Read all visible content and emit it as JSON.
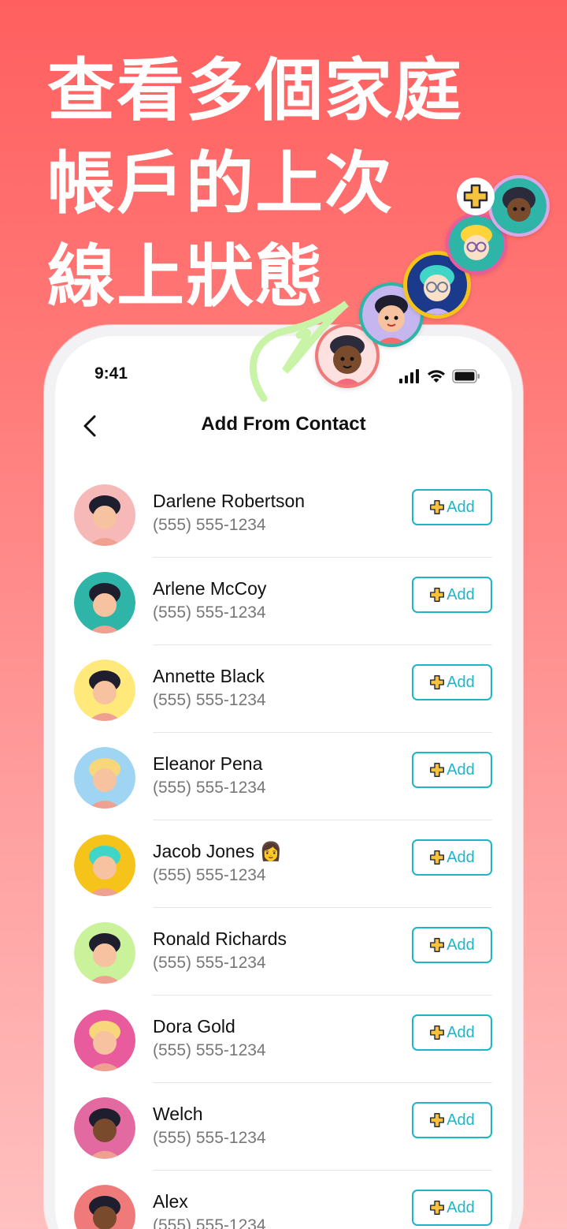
{
  "headline": [
    "查看多個家庭",
    "帳戶的上次",
    "線上狀態"
  ],
  "status_bar": {
    "time": "9:41"
  },
  "navbar": {
    "title": "Add From Contact"
  },
  "contacts": [
    {
      "name": "Darlene Robertson",
      "phone": "(555) 555-1234",
      "add_label": "Add",
      "avatar_bg": "#f7b8b8",
      "avatar": "woman-dark-hair"
    },
    {
      "name": "Arlene McCoy",
      "phone": "(555) 555-1234",
      "add_label": "Add",
      "avatar_bg": "#2fb5a8",
      "avatar": "boy-dark-hair"
    },
    {
      "name": "Annette Black",
      "phone": "(555) 555-1234",
      "add_label": "Add",
      "avatar_bg": "#ffe97a",
      "avatar": "woman-bun"
    },
    {
      "name": "Eleanor Pena",
      "phone": "(555) 555-1234",
      "add_label": "Add",
      "avatar_bg": "#9fd5f2",
      "avatar": "woman-blonde"
    },
    {
      "name": "Jacob Jones 👩",
      "phone": "(555) 555-1234",
      "add_label": "Add",
      "avatar_bg": "#f5c31a",
      "avatar": "teal-hair-glasses"
    },
    {
      "name": "Ronald Richards",
      "phone": "(555) 555-1234",
      "add_label": "Add",
      "avatar_bg": "#c9f29a",
      "avatar": "man-black-hair"
    },
    {
      "name": "Dora Gold",
      "phone": "(555) 555-1234",
      "add_label": "Add",
      "avatar_bg": "#e85b9c",
      "avatar": "blonde-glasses"
    },
    {
      "name": "Welch",
      "phone": "(555) 555-1234",
      "add_label": "Add",
      "avatar_bg": "#e36aa0",
      "avatar": "girl-curly"
    },
    {
      "name": "Alex",
      "phone": "(555) 555-1234",
      "add_label": "Add",
      "avatar_bg": "#f07a7a",
      "avatar": "boy-curly"
    }
  ],
  "colors": {
    "accent": "#1fb5c9",
    "plus": "#f7c33d",
    "background_top": "#ff5f5f"
  }
}
